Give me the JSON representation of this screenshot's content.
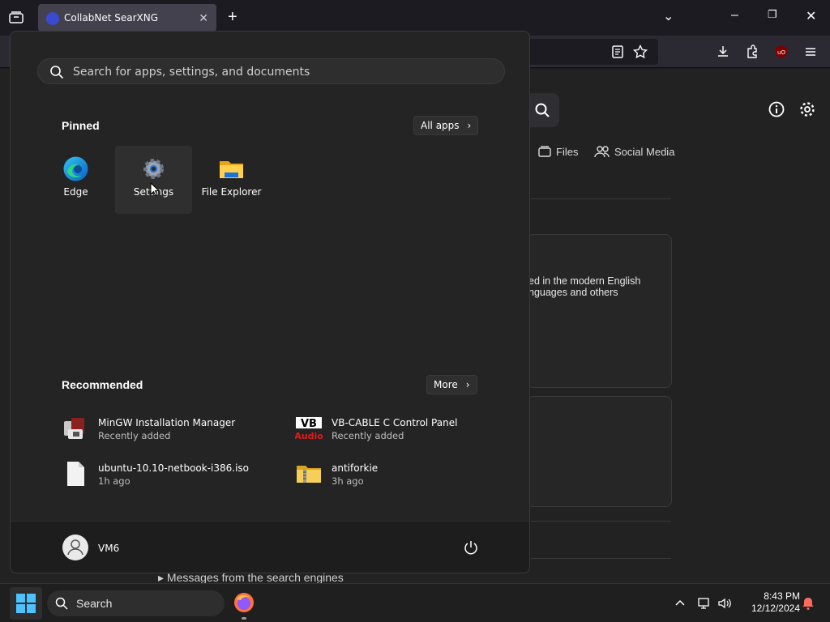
{
  "browser": {
    "tab_title": "CollabNet SearXNG",
    "new_tab_label": "+"
  },
  "page": {
    "categories": [
      {
        "label": "Files",
        "icon": "files-icon"
      },
      {
        "label": "Social Media",
        "icon": "social-media-icon"
      }
    ],
    "card_text_line1": "ed in the modern English",
    "card_text_line2": "nguages and others",
    "messages_label": "▸ Messages from the search engines"
  },
  "start_menu": {
    "search_placeholder": "Search for apps, settings, and documents",
    "pinned_title": "Pinned",
    "all_apps_label": "All apps",
    "pinned_apps": [
      {
        "label": "Edge",
        "icon": "edge-icon"
      },
      {
        "label": "Settings",
        "icon": "settings-gear-icon"
      },
      {
        "label": "File Explorer",
        "icon": "file-explorer-icon"
      }
    ],
    "recommended_title": "Recommended",
    "more_label": "More",
    "recommended": [
      {
        "name": "MinGW Installation Manager",
        "sub": "Recently added",
        "icon": "mingw-icon"
      },
      {
        "name": "VB-CABLE C Control Panel",
        "sub": "Recently added",
        "icon": "vb-audio-icon"
      },
      {
        "name": "ubuntu-10.10-netbook-i386.iso",
        "sub": "1h ago",
        "icon": "file-icon"
      },
      {
        "name": "antiforkie",
        "sub": "3h ago",
        "icon": "zip-folder-icon"
      }
    ],
    "user_name": "VM6"
  },
  "taskbar": {
    "search_label": "Search",
    "time": "8:43 PM",
    "date": "12/12/2024"
  },
  "colors": {
    "accent_blue": "#0078d4",
    "start_bg": "#242424",
    "taskbar_bg": "#1f1f1f"
  }
}
